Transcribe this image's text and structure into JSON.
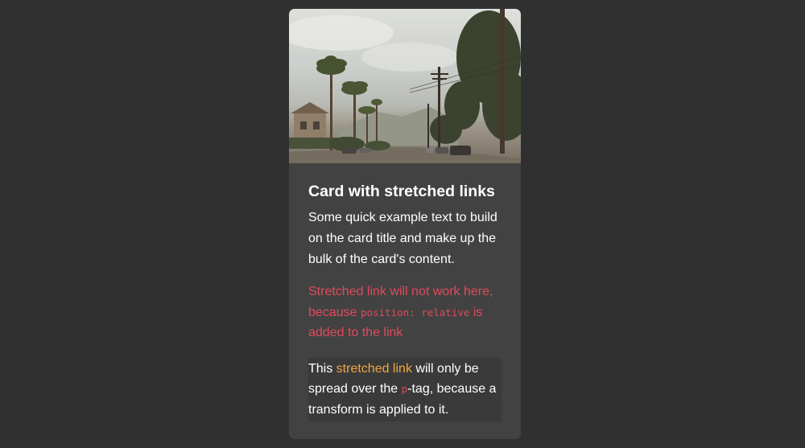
{
  "card": {
    "image": {
      "alt": "street-with-palm-trees",
      "icon": "photo-image"
    },
    "title": "Card with stretched links",
    "text": "Some quick example text to build on the card title and make up the bulk of the card's content.",
    "warning": {
      "part1": "Stretched link will not work here, because ",
      "code": "position: relative",
      "part2": " is added to the link"
    },
    "note": {
      "before": "This ",
      "link": "stretched link",
      "middle": " will only be spread over the ",
      "code": "p",
      "after": "-tag, because a transform is applied to it."
    }
  },
  "colors": {
    "page_background": "#303030",
    "card_background": "#424242",
    "warning_text": "#e04a5c",
    "link": "#f0a640"
  }
}
